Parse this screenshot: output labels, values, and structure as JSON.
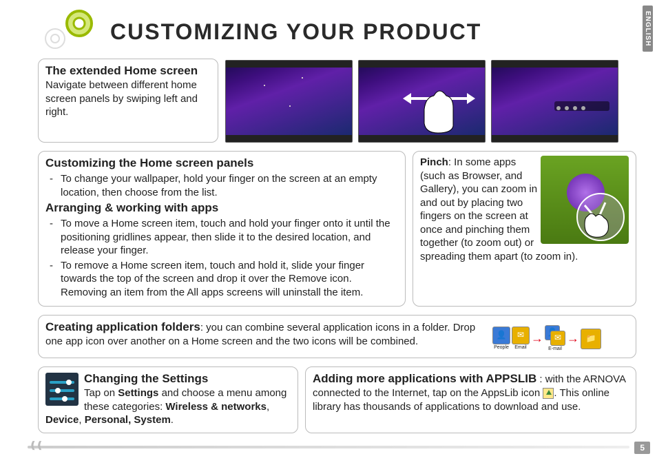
{
  "language_tab": "ENGLISH",
  "title": "CUSTOMIZING YOUR PRODUCT",
  "page_number": "5",
  "extended_home": {
    "heading": "The extended Home screen",
    "body": "Navigate between different home screen panels by swiping left and right."
  },
  "customizing_panels": {
    "heading": "Customizing the Home screen panels",
    "wallpaper": "To change your wallpaper, hold your finger on the screen at an empty location, then choose from the list.",
    "arranging_heading": "Arranging & working with apps",
    "move_item": "To move a Home screen item, touch and hold your finger onto it until the positioning gridlines appear, then slide it to the desired location, and release your finger.",
    "remove_item": "To remove a Home screen item, touch and hold it, slide your finger towards the top of the screen and drop it over the Remove icon. Removing an item from the All apps screens will uninstall the item."
  },
  "pinch": {
    "heading": "Pinch",
    "body": ": In some apps (such as Browser, and Gallery), you can zoom in and out by placing two fingers on the screen at once and pinching them together (to zoom out) or spreading them apart (to zoom in)."
  },
  "folders": {
    "heading": "Creating application folders",
    "body": ": you can combine several application icons in a folder. Drop one app icon over another on a Home screen and the two icons will be combined.",
    "icon_people": "People",
    "icon_email": "Email",
    "icon_email2": "E-mail"
  },
  "settings": {
    "heading": "Changing the Settings",
    "tap_on": "Tap on ",
    "settings_word": "Settings",
    "middle": " and choose a menu among these categories: ",
    "cats": "Wireless & networks",
    "sep": ", ",
    "device": "Device",
    "personal_system": "Personal, System",
    "period": "."
  },
  "appslib": {
    "heading": "Adding more applications with APPSLIB",
    "body1": " : with the ARNOVA connected to the Internet, tap on the AppsLib icon ",
    "body2": ". This online library has thousands of applications to download and use."
  }
}
